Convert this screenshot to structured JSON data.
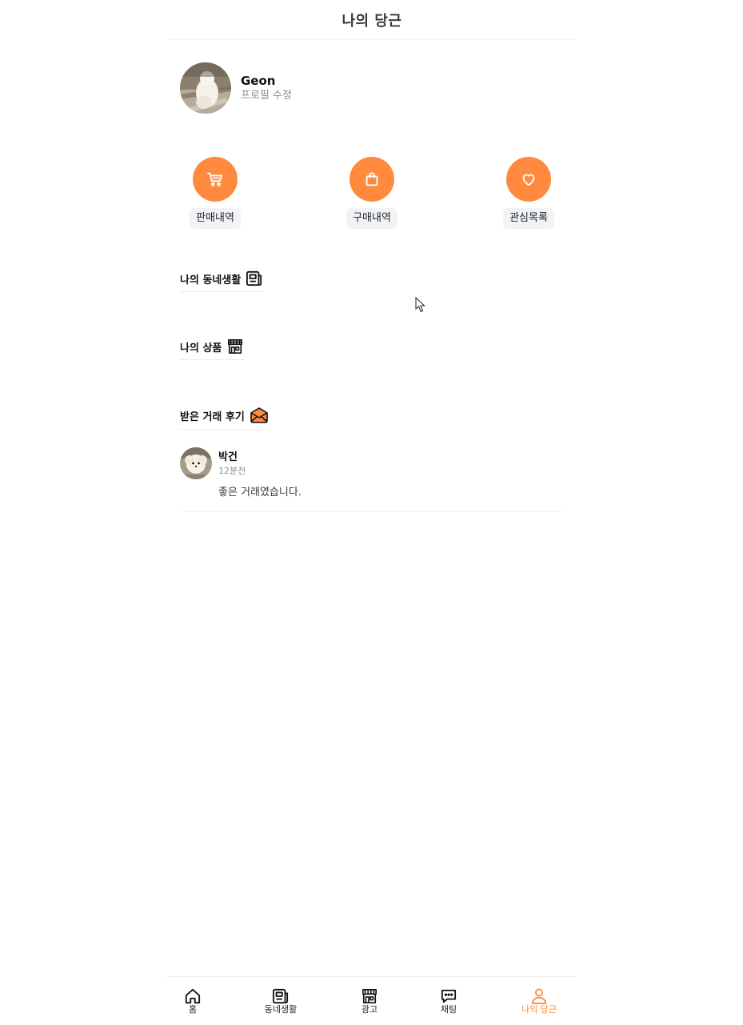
{
  "header": {
    "title": "나의 당근"
  },
  "profile": {
    "name": "Geon",
    "edit_label": "프로필 수정",
    "avatar_icon": "dog-photo-avatar"
  },
  "quick_actions": [
    {
      "label": "판매내역",
      "icon": "cart-icon"
    },
    {
      "label": "구매내역",
      "icon": "shopping-bag-icon"
    },
    {
      "label": "관심목록",
      "icon": "heart-icon"
    }
  ],
  "sections": {
    "neighborhood": {
      "title": "나의 동네생활",
      "icon": "newspaper-icon"
    },
    "products": {
      "title": "나의 상품",
      "icon": "store-icon"
    },
    "reviews": {
      "title": "받은 거래 후기",
      "icon": "envelope-icon"
    }
  },
  "reviews": [
    {
      "name": "박건",
      "time": "12분전",
      "text": "좋은 거래였습니다."
    }
  ],
  "bottom_nav": {
    "home": "홈",
    "neighborhood": "동네생활",
    "ads": "광고",
    "chat": "채팅",
    "my": "나의 당근"
  },
  "colors": {
    "accent": "#ff8a3d",
    "chip_bg": "#f1f3f5",
    "muted": "#868e96"
  }
}
